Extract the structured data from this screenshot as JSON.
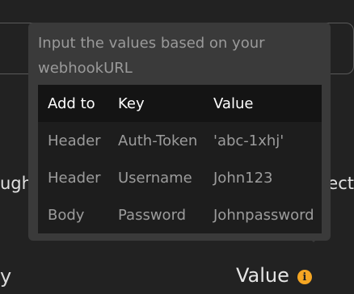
{
  "background": {
    "left_fragment": "ugh",
    "right_fragment": "ect",
    "bottom_left_fragment": "y",
    "value_label": "Value",
    "info_icon": "info-icon",
    "info_icon_glyph": "i"
  },
  "tooltip": {
    "description": "Input the values based on your webhookURL",
    "table": {
      "headers": [
        "Add to",
        "Key",
        "Value"
      ],
      "rows": [
        [
          "Header",
          "Auth-Token",
          "'abc-1xhj'"
        ],
        [
          "Header",
          "Username",
          "John123"
        ],
        [
          "Body",
          "Password",
          "Johnpassword"
        ]
      ]
    }
  },
  "colors": {
    "accent": "#f5a623",
    "background": "#222222",
    "tooltip": "#3a3a3a",
    "table_header": "#141414",
    "table_body": "#1d1d1d"
  }
}
